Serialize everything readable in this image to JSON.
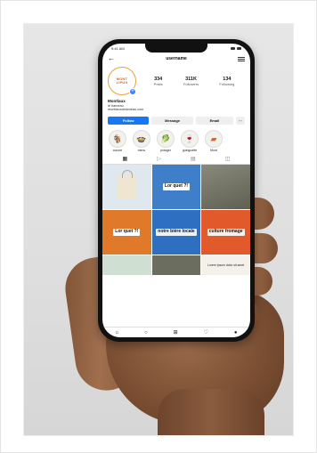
{
  "profile": {
    "username": "username",
    "avatar_text_line1": "MONT",
    "avatar_text_line2": "LIPUX",
    "stats": [
      {
        "value": "334",
        "label": "Posts"
      },
      {
        "value": "311K",
        "label": "Followers"
      },
      {
        "value": "134",
        "label": "Following"
      }
    ],
    "bio": {
      "name": "Montlaux",
      "line1": "le hameau",
      "line2": "montlauxdelameau.com"
    }
  },
  "buttons": {
    "follow": "Follow",
    "message": "Message",
    "email": "Email",
    "more": "···"
  },
  "highlights": [
    {
      "label": "couvre",
      "icon": "goat-icon",
      "glyph": "🐐"
    },
    {
      "label": "menu",
      "icon": "cocotte-icon",
      "glyph": "🍲"
    },
    {
      "label": "potager",
      "icon": "leaf-icon",
      "glyph": "🥬"
    },
    {
      "label": "guinguette",
      "icon": "glasses-icon",
      "glyph": "🍷"
    },
    {
      "label": "Mont",
      "icon": "mont-icon",
      "glyph": "▰"
    }
  ],
  "grid_posts": [
    {
      "text": "",
      "kind": "tote"
    },
    {
      "text": "Lor quet ?!",
      "kind": "sign"
    },
    {
      "text": "",
      "kind": "photo"
    },
    {
      "text": "Lor quet ?!",
      "kind": "sign"
    },
    {
      "text": "notre bière locale",
      "kind": "bottle"
    },
    {
      "text": "culture fromage",
      "kind": "sign"
    },
    {
      "text": "",
      "kind": "plant"
    },
    {
      "text": "",
      "kind": "photo"
    },
    {
      "text": "Lorem Ipsum dolor sit amet",
      "kind": "text"
    }
  ],
  "status": {
    "time": "9:41 AM"
  },
  "colors": {
    "follow": "#1877f2",
    "avatar_ring": "#e8a23a",
    "brand_orange": "#e8601c"
  }
}
